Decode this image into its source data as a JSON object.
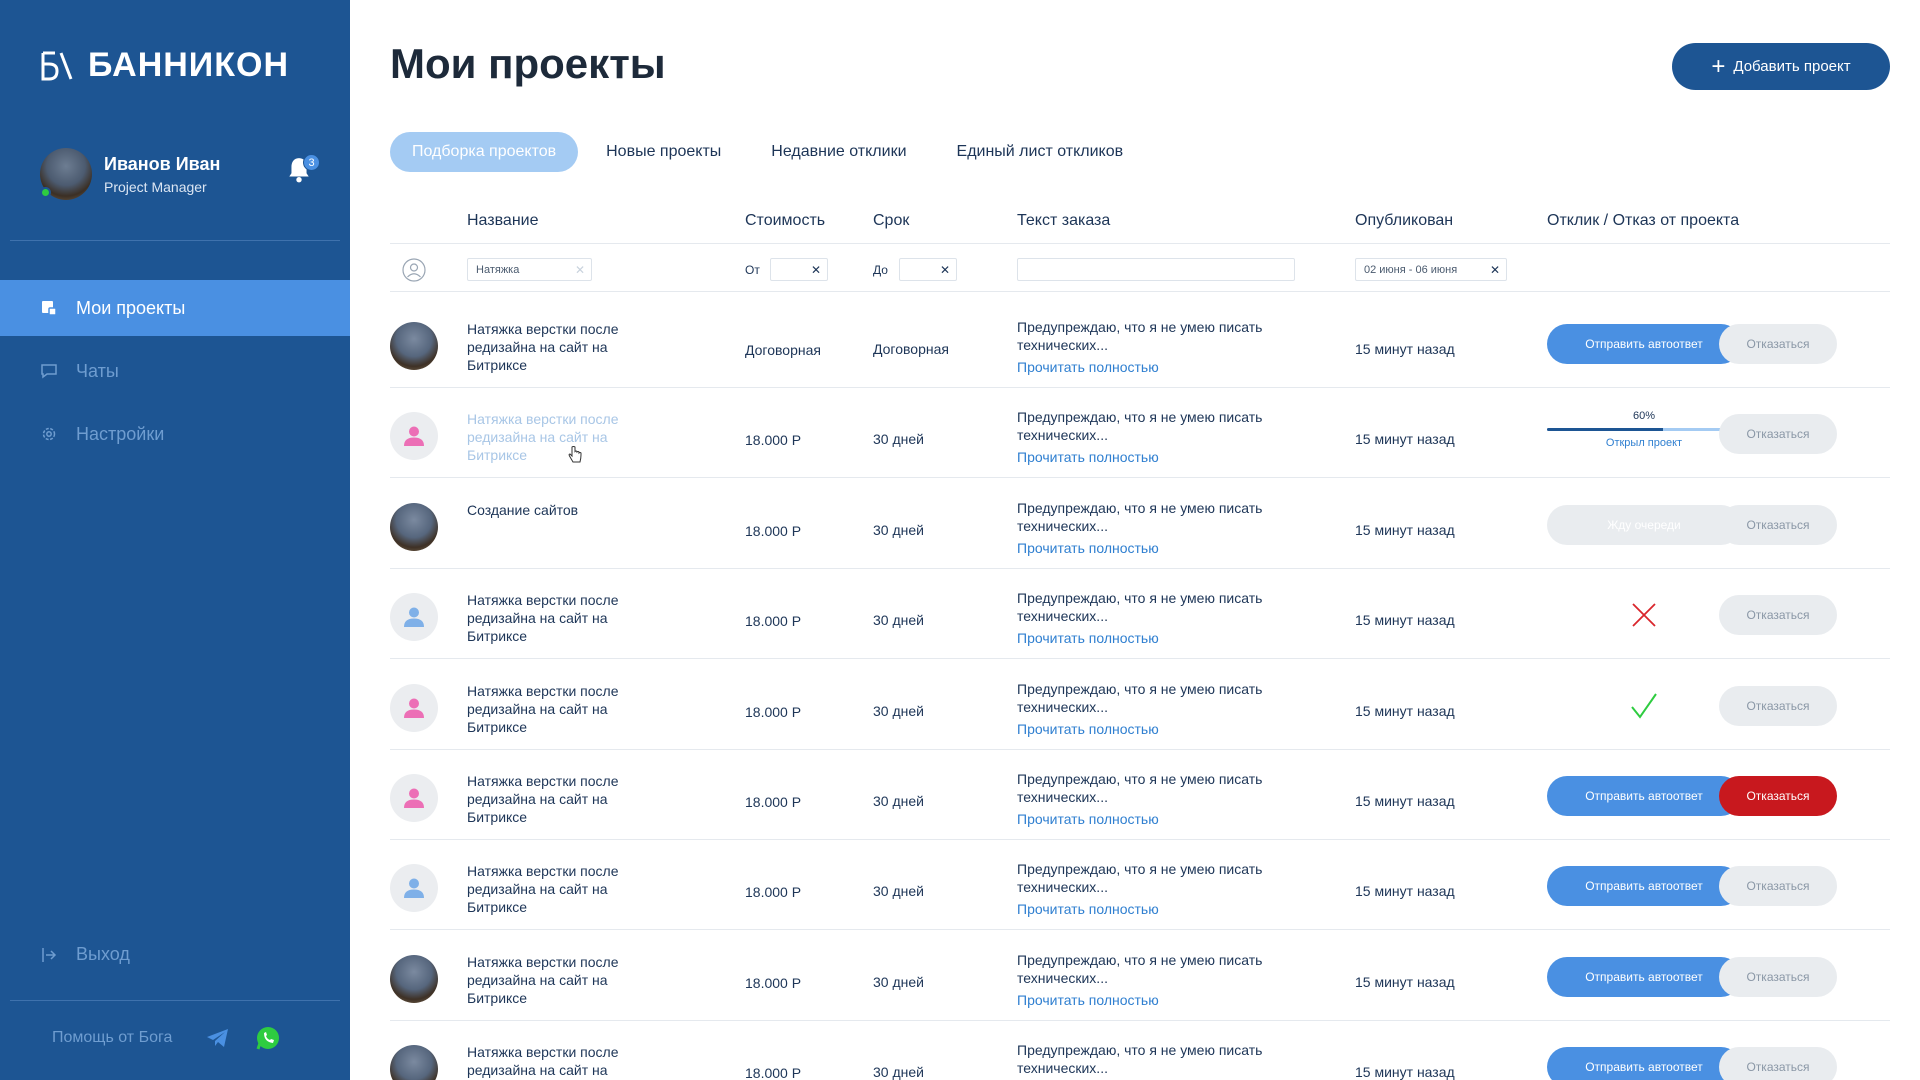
{
  "brand": {
    "name": "БАННИКОН"
  },
  "user": {
    "name": "Иванов Иван",
    "role": "Project Manager",
    "notifications": "3"
  },
  "nav": [
    {
      "label": "Мои проекты",
      "icon": "projects-icon",
      "active": true
    },
    {
      "label": "Чаты",
      "icon": "chat-icon",
      "active": false
    },
    {
      "label": "Настройки",
      "icon": "gear-icon",
      "active": false
    }
  ],
  "logout": "Выход",
  "help": "Помощь от Бога",
  "page": {
    "title": "Мои проекты",
    "add_button": "Добавить проект"
  },
  "tabs": [
    {
      "label": "Подборка проектов",
      "active": true
    },
    {
      "label": "Новые проекты",
      "active": false
    },
    {
      "label": "Недавние отклики",
      "active": false
    },
    {
      "label": "Единый лист откликов",
      "active": false
    }
  ],
  "columns": {
    "name": "Название",
    "cost": "Стоимость",
    "term": "Срок",
    "text": "Текст заказа",
    "published": "Опубликован",
    "response": "Отклик / Отказ от проекта"
  },
  "filters": {
    "name_value": "Натяжка",
    "cost_from_label": "От",
    "term_to_label": "До",
    "date_range": "02 июня - 06 июня"
  },
  "actions": {
    "auto_reply": "Отправить автоответ",
    "refuse": "Отказаться",
    "waiting": "Жду очереди",
    "read_more": "Прочитать полностью",
    "opened": "Открыл проект"
  },
  "rows": [
    {
      "avatar": "photo",
      "name": "Натяжка верстки после редизайна на сайт на Битриксе",
      "cost": "Договорная",
      "term": "Договорная",
      "text": "Предупреждаю, что я не умею писать технических...",
      "published": "15 минут назад",
      "status": "auto",
      "refuse_style": "normal"
    },
    {
      "avatar": "pink",
      "name": "Натяжка верстки после редизайна на сайт на Битриксе",
      "cost": "18.000 Р",
      "term": "30 дней",
      "text": "Предупреждаю, что я не умею писать технических...",
      "published": "15 минут назад",
      "status": "progress",
      "progress_label": "60%",
      "progress_value": 60,
      "refuse_style": "normal",
      "muted": true
    },
    {
      "avatar": "photo",
      "name": "Создание сайтов",
      "cost": "18.000 Р",
      "term": "30 дней",
      "text": "Предупреждаю, что я не умею писать технических...",
      "published": "15 минут назад",
      "status": "waiting",
      "refuse_style": "normal"
    },
    {
      "avatar": "blue",
      "name": "Натяжка верстки после редизайна на сайт на Битриксе",
      "cost": "18.000 Р",
      "term": "30 дней",
      "text": "Предупреждаю, что я не умею писать технических...",
      "published": "15 минут назад",
      "status": "rejected",
      "refuse_style": "normal"
    },
    {
      "avatar": "pink",
      "name": "Натяжка верстки после редизайна на сайт на Битриксе",
      "cost": "18.000 Р",
      "term": "30 дней",
      "text": "Предупреждаю, что я не умею писать технических...",
      "published": "15 минут назад",
      "status": "accepted",
      "refuse_style": "normal"
    },
    {
      "avatar": "pink",
      "name": "Натяжка верстки после редизайна на сайт на Битриксе",
      "cost": "18.000 Р",
      "term": "30 дней",
      "text": "Предупреждаю, что я не умею писать технических...",
      "published": "15 минут назад",
      "status": "auto",
      "refuse_style": "red"
    },
    {
      "avatar": "blue",
      "name": "Натяжка верстки после редизайна на сайт на Битриксе",
      "cost": "18.000 Р",
      "term": "30 дней",
      "text": "Предупреждаю, что я не умею писать технических...",
      "published": "15 минут назад",
      "status": "auto",
      "refuse_style": "normal"
    },
    {
      "avatar": "photo",
      "name": "Натяжка верстки после редизайна на сайт на Битриксе",
      "cost": "18.000 Р",
      "term": "30 дней",
      "text": "Предупреждаю, что я не умею писать технических...",
      "published": "15 минут назад",
      "status": "auto",
      "refuse_style": "normal"
    },
    {
      "avatar": "photo",
      "name": "Натяжка верстки после редизайна на сайт на Битриксе",
      "cost": "18.000 Р",
      "term": "30 дней",
      "text": "Предупреждаю, что я не умею писать технических...",
      "published": "15 минут назад",
      "status": "auto",
      "refuse_style": "normal"
    }
  ],
  "colors": {
    "sidebar": "#1d5593",
    "accent": "#4a90e2",
    "tab_active": "#a4cbf3",
    "danger": "#c8181e",
    "link": "#2f7fd0",
    "avatar_pink": "#ec6fb6",
    "avatar_blue": "#7fb0e8"
  }
}
